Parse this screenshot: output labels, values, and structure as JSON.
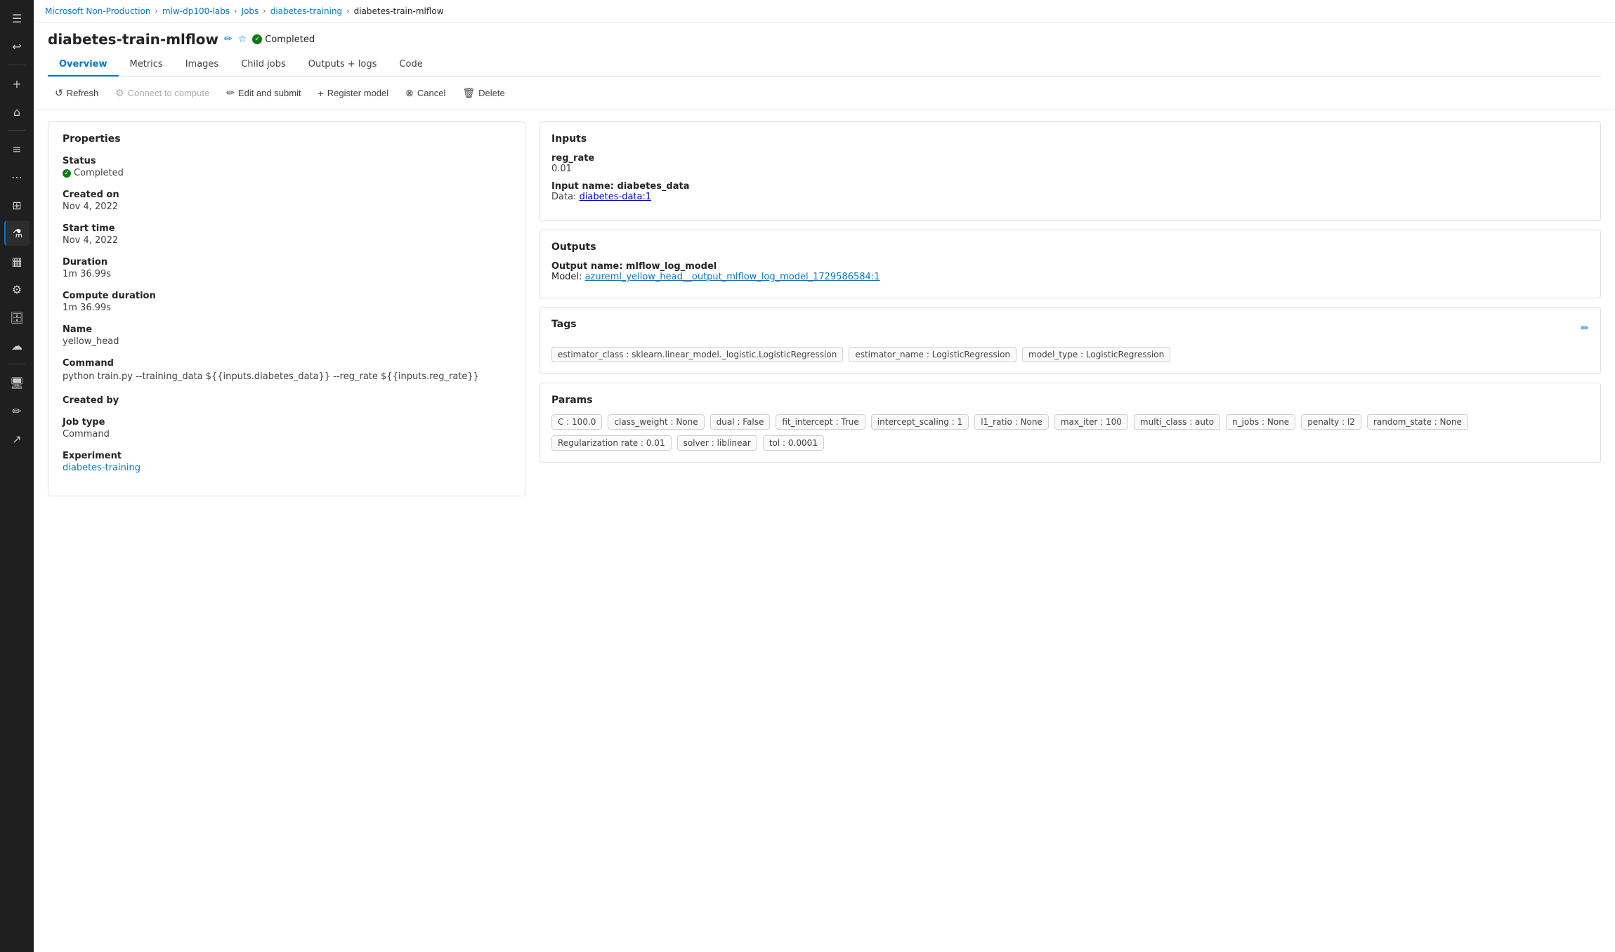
{
  "sidebar": {
    "icons": [
      {
        "name": "menu-icon",
        "symbol": "☰"
      },
      {
        "name": "back-icon",
        "symbol": "↩"
      },
      {
        "name": "add-icon",
        "symbol": "+"
      },
      {
        "name": "home-icon",
        "symbol": "⌂"
      },
      {
        "name": "list-icon",
        "symbol": "☰"
      },
      {
        "name": "pipeline-icon",
        "symbol": "⋯"
      },
      {
        "name": "compute-icon",
        "symbol": "⊞"
      },
      {
        "name": "lab-icon",
        "symbol": "⚗",
        "active": true
      },
      {
        "name": "dashboard-icon",
        "symbol": "⊟"
      },
      {
        "name": "notebook-icon",
        "symbol": "📓"
      },
      {
        "name": "storage-icon",
        "symbol": "🗄"
      },
      {
        "name": "cloud-icon",
        "symbol": "☁"
      },
      {
        "name": "monitor-icon",
        "symbol": "🖥"
      },
      {
        "name": "pencil-icon",
        "symbol": "✏"
      },
      {
        "name": "export-icon",
        "symbol": "↗"
      }
    ]
  },
  "breadcrumb": {
    "items": [
      {
        "label": "Microsoft Non-Production",
        "link": true
      },
      {
        "label": "mlw-dp100-labs",
        "link": true
      },
      {
        "label": "Jobs",
        "link": true
      },
      {
        "label": "diabetes-training",
        "link": true
      },
      {
        "label": "diabetes-train-mlflow",
        "link": false
      }
    ]
  },
  "page": {
    "title": "diabetes-train-mlflow",
    "status": "Completed",
    "tabs": [
      {
        "label": "Overview",
        "active": true
      },
      {
        "label": "Metrics",
        "active": false
      },
      {
        "label": "Images",
        "active": false
      },
      {
        "label": "Child jobs",
        "active": false
      },
      {
        "label": "Outputs + logs",
        "active": false
      },
      {
        "label": "Code",
        "active": false
      }
    ]
  },
  "toolbar": {
    "buttons": [
      {
        "label": "Refresh",
        "icon": "↺",
        "name": "refresh-button",
        "disabled": false
      },
      {
        "label": "Connect to compute",
        "icon": "⚙",
        "name": "connect-compute-button",
        "disabled": true
      },
      {
        "label": "Edit and submit",
        "icon": "✏",
        "name": "edit-submit-button",
        "disabled": false
      },
      {
        "label": "Register model",
        "icon": "+",
        "name": "register-model-button",
        "disabled": false
      },
      {
        "label": "Cancel",
        "icon": "⊗",
        "name": "cancel-button",
        "disabled": false
      },
      {
        "label": "Delete",
        "icon": "🗑",
        "name": "delete-button",
        "disabled": false
      }
    ]
  },
  "properties": {
    "title": "Properties",
    "fields": [
      {
        "label": "Status",
        "value": "Completed",
        "type": "status"
      },
      {
        "label": "Created on",
        "value": "Nov 4, 2022",
        "type": "text"
      },
      {
        "label": "Start time",
        "value": "Nov 4, 2022",
        "type": "text"
      },
      {
        "label": "Duration",
        "value": "1m 36.99s",
        "type": "text"
      },
      {
        "label": "Compute duration",
        "value": "1m 36.99s",
        "type": "text"
      },
      {
        "label": "Name",
        "value": "yellow_head",
        "type": "text"
      },
      {
        "label": "Command",
        "value": "python train.py --training_data ${{inputs.diabetes_data}} --reg_rate ${{inputs.reg_rate}}",
        "type": "code"
      },
      {
        "label": "Created by",
        "value": "",
        "type": "text"
      },
      {
        "label": "Job type",
        "value": "Command",
        "type": "text"
      },
      {
        "label": "Experiment",
        "value": "diabetes-training",
        "type": "link"
      }
    ]
  },
  "inputs": {
    "title": "Inputs",
    "reg_rate_label": "reg_rate",
    "reg_rate_value": "0.01",
    "input_name_label": "Input name: diabetes_data",
    "data_label": "Data:",
    "data_link": "diabetes-data:1"
  },
  "outputs": {
    "title": "Outputs",
    "output_name_label": "Output name: mlflow_log_model",
    "model_label": "Model:",
    "model_link_1": "azureml_yellow_head_",
    "model_link_2": "_output_mlflow_log_model_1729586584:1"
  },
  "tags": {
    "title": "Tags",
    "items": [
      "estimator_class : sklearn.linear_model._logistic.LogisticRegression",
      "estimator_name : LogisticRegression",
      "model_type : LogisticRegression"
    ]
  },
  "params": {
    "title": "Params",
    "items": [
      "C : 100.0",
      "class_weight : None",
      "dual : False",
      "fit_intercept : True",
      "intercept_scaling : 1",
      "l1_ratio : None",
      "max_iter : 100",
      "multi_class : auto",
      "n_jobs : None",
      "penalty : l2",
      "random_state : None",
      "Regularization rate : 0.01",
      "solver : liblinear",
      "tol : 0.0001"
    ]
  }
}
